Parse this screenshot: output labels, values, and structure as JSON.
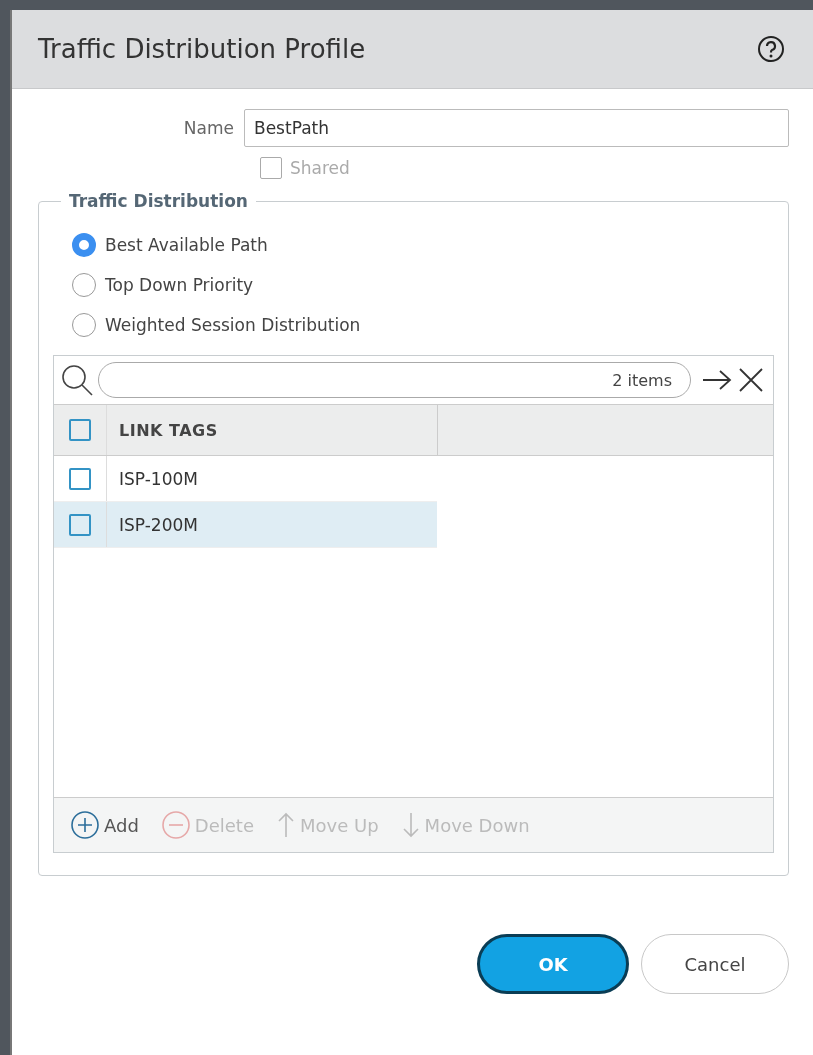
{
  "window": {
    "title": "Traffic Distribution Profile"
  },
  "name_field": {
    "label": "Name",
    "value": "BestPath"
  },
  "shared": {
    "label": "Shared",
    "checked": false,
    "disabled": true
  },
  "traffic_distribution": {
    "legend": "Traffic Distribution",
    "options": [
      {
        "label": "Best Available Path",
        "selected": true
      },
      {
        "label": "Top Down Priority",
        "selected": false
      },
      {
        "label": "Weighted Session Distribution",
        "selected": false
      }
    ],
    "table": {
      "count": "2 items",
      "columns": [
        "LINK TAGS"
      ],
      "header_checked": false,
      "rows": [
        {
          "cells": [
            "ISP-100M"
          ],
          "checked": false,
          "selected": false
        },
        {
          "cells": [
            "ISP-200M"
          ],
          "checked": false,
          "selected": true
        }
      ],
      "actions": [
        {
          "kind": "add",
          "label": "Add",
          "disabled": false
        },
        {
          "kind": "delete",
          "label": "Delete",
          "disabled": true
        },
        {
          "kind": "up",
          "label": "Move Up",
          "disabled": true
        },
        {
          "kind": "down",
          "label": "Move Down",
          "disabled": true
        }
      ]
    }
  },
  "buttons": [
    {
      "label": "OK",
      "kind": "primary"
    },
    {
      "label": "Cancel",
      "kind": "secondary"
    }
  ]
}
